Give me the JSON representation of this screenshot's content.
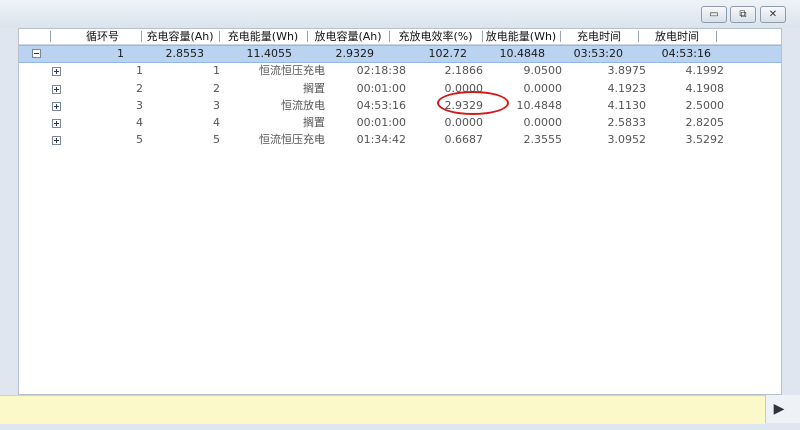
{
  "headers": [
    "循环号",
    "充电容量(Ah)",
    "充电能量(Wh)",
    "放电容量(Ah)",
    "充放电效率(%)",
    "放电能量(Wh)",
    "充电时间",
    "放电时间"
  ],
  "summary": [
    "1",
    "2.8553",
    "11.4055",
    "2.9329",
    "102.72",
    "10.4848",
    "03:53:20",
    "04:53:16"
  ],
  "details": [
    [
      "1",
      "1",
      "恒流恒压充电",
      "02:18:38",
      "2.1866",
      "9.0500",
      "3.8975",
      "4.1992"
    ],
    [
      "2",
      "2",
      "搁置",
      "00:01:00",
      "0.0000",
      "0.0000",
      "4.1923",
      "4.1908"
    ],
    [
      "3",
      "3",
      "恒流放电",
      "04:53:16",
      "2.9329",
      "10.4848",
      "4.1130",
      "2.5000"
    ],
    [
      "4",
      "4",
      "搁置",
      "00:01:00",
      "0.0000",
      "0.0000",
      "2.5833",
      "2.8205"
    ],
    [
      "5",
      "5",
      "恒流恒压充电",
      "01:34:42",
      "0.6687",
      "2.3555",
      "3.0952",
      "3.5292"
    ]
  ],
  "window_controls": {
    "minimize": "▭",
    "restore": "⧉",
    "close": "✕"
  },
  "icons": {
    "scroll_right": "▶"
  }
}
